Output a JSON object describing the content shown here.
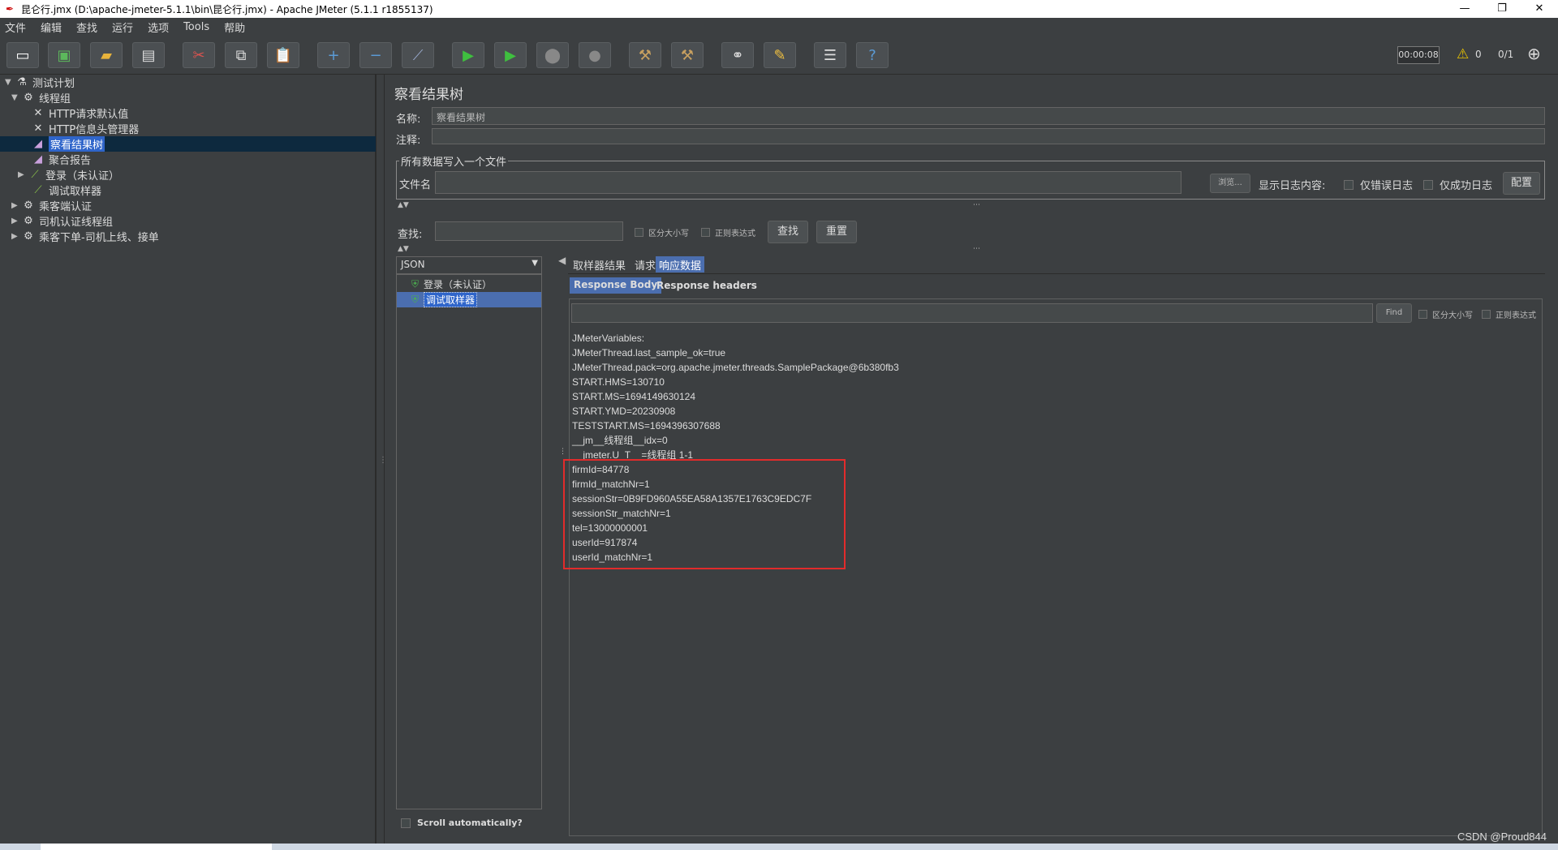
{
  "window": {
    "title": "昆仑行.jmx (D:\\apache-jmeter-5.1.1\\bin\\昆仑行.jmx) - Apache JMeter (5.1.1 r1855137)",
    "minimize": "—",
    "restore": "❐",
    "close": "✕"
  },
  "menu": [
    "文件",
    "编辑",
    "查找",
    "运行",
    "选项",
    "Tools",
    "帮助"
  ],
  "toolbar": {
    "timer": "00:00:08",
    "warn_count": "0",
    "threads": "0/1"
  },
  "tree": {
    "items": [
      {
        "label": "测试计划",
        "icon": "flask-icon"
      },
      {
        "label": "线程组",
        "icon": "gear-icon"
      },
      {
        "label": "HTTP请求默认值",
        "icon": "wrench-icon"
      },
      {
        "label": "HTTP信息头管理器",
        "icon": "wrench-icon"
      },
      {
        "label": "察看结果树",
        "icon": "chart-icon"
      },
      {
        "label": "聚合报告",
        "icon": "chart-icon"
      },
      {
        "label": "登录（未认证）",
        "icon": "pipette-icon"
      },
      {
        "label": "调试取样器",
        "icon": "pipette-icon"
      },
      {
        "label": "乘客端认证",
        "icon": "gear-icon"
      },
      {
        "label": "司机认证线程组",
        "icon": "gear-icon"
      },
      {
        "label": "乘客下单-司机上线、接单",
        "icon": "gear-icon"
      }
    ]
  },
  "panel": {
    "title": "察看结果树",
    "name_label": "名称:",
    "name_value": "察看结果树",
    "comment_label": "注释:",
    "file_group": "所有数据写入一个文件",
    "filename_label": "文件名",
    "browse": "浏览...",
    "log_label": "显示日志内容:",
    "errors_only": "仅错误日志",
    "success_only": "仅成功日志",
    "configure": "配置",
    "search_label": "查找:",
    "case_sensitive": "区分大小写",
    "regex": "正则表达式",
    "search_btn": "查找",
    "reset_btn": "重置"
  },
  "results": {
    "renderer": "JSON",
    "samples": [
      {
        "label": "登录（未认证）",
        "selected": false
      },
      {
        "label": "调试取样器",
        "selected": true
      }
    ],
    "autoscroll": "Scroll automatically?",
    "tabs": [
      "取样器结果",
      "请求",
      "响应数据"
    ],
    "active_tab": "响应数据",
    "subtabs": [
      "Response Body",
      "Response headers"
    ],
    "find_btn": "Find",
    "find_case": "区分大小写",
    "find_regex": "正则表达式",
    "body_lines": [
      "JMeterVariables:",
      "JMeterThread.last_sample_ok=true",
      "JMeterThread.pack=org.apache.jmeter.threads.SamplePackage@6b380fb3",
      "START.HMS=130710",
      "START.MS=1694149630124",
      "START.YMD=20230908",
      "TESTSTART.MS=1694396307688",
      "__jm__线程组__idx=0",
      "__jmeter.U_T__=线程组 1-1",
      "firmId=84778",
      "firmId_matchNr=1",
      "sessionStr=0B9FD960A55EA58A1357E1763C9EDC7F",
      "sessionStr_matchNr=1",
      "tel=13000000001",
      "userId=917874",
      "userId_matchNr=1"
    ]
  },
  "watermark": "CSDN @Proud844",
  "colors": {
    "background": "#3c3f41",
    "selection": "#4b6eaf",
    "highlight_box": "#e22b2b"
  }
}
